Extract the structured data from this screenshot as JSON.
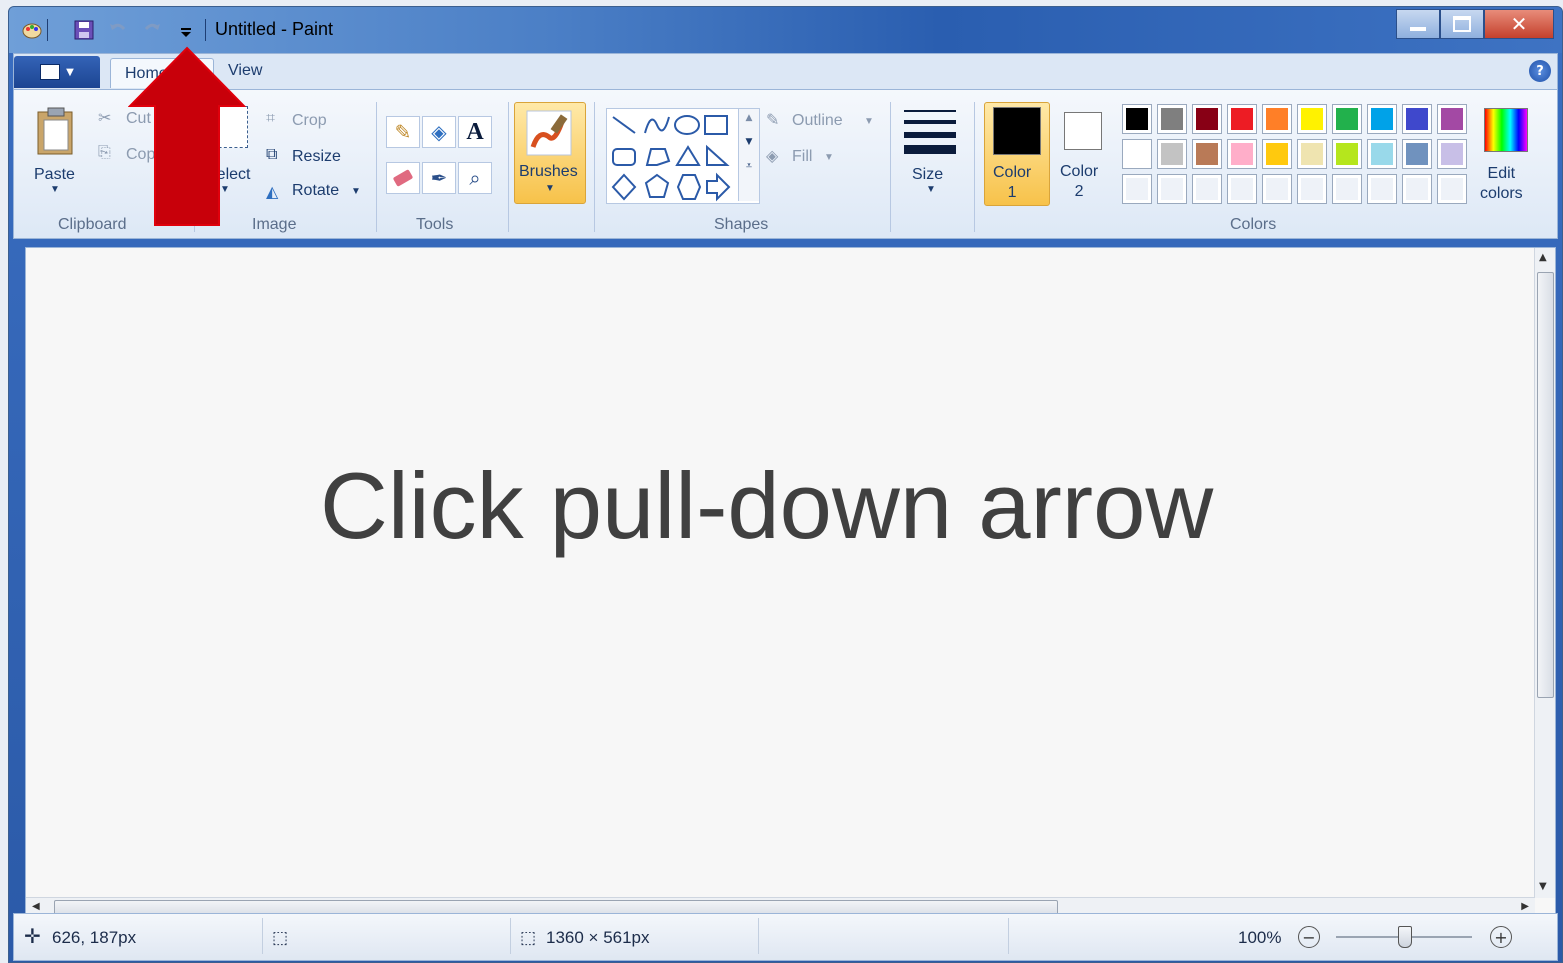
{
  "window": {
    "title": "Untitled - Paint"
  },
  "tabs": {
    "home": "Home",
    "view": "View"
  },
  "clipboard": {
    "paste": "Paste",
    "cut": "Cut",
    "copy": "Copy",
    "label": "Clipboard"
  },
  "image": {
    "select": "Select",
    "crop": "Crop",
    "resize": "Resize",
    "rotate": "Rotate",
    "label": "Image"
  },
  "tools": {
    "label": "Tools"
  },
  "brushes": {
    "label": "Brushes"
  },
  "shapes": {
    "outline": "Outline",
    "fill": "Fill",
    "label": "Shapes"
  },
  "size": {
    "label": "Size"
  },
  "colors": {
    "color1": "Color\n1",
    "color2": "Color\n2",
    "edit": "Edit\ncolors",
    "label": "Colors",
    "palette_row1": [
      "#000000",
      "#7f7f7f",
      "#880015",
      "#ed1c24",
      "#ff7f27",
      "#fff200",
      "#22b14c",
      "#00a2e8",
      "#3f48cc",
      "#a349a4"
    ],
    "palette_row2": [
      "#ffffff",
      "#c3c3c3",
      "#b97a57",
      "#ffaec9",
      "#ffc90e",
      "#efe4b0",
      "#b5e61d",
      "#99d9ea",
      "#7092be",
      "#c8bfe7"
    ],
    "palette_row3": [
      "#eef2f8",
      "#eef2f8",
      "#eef2f8",
      "#eef2f8",
      "#eef2f8",
      "#eef2f8",
      "#eef2f8",
      "#eef2f8",
      "#eef2f8",
      "#eef2f8"
    ]
  },
  "canvas": {
    "instruction": "Click pull-down arrow"
  },
  "status": {
    "cursor": "626, 187px",
    "image_size": "1360 × 561px",
    "zoom": "100%",
    "zoom_level": 0.5
  }
}
